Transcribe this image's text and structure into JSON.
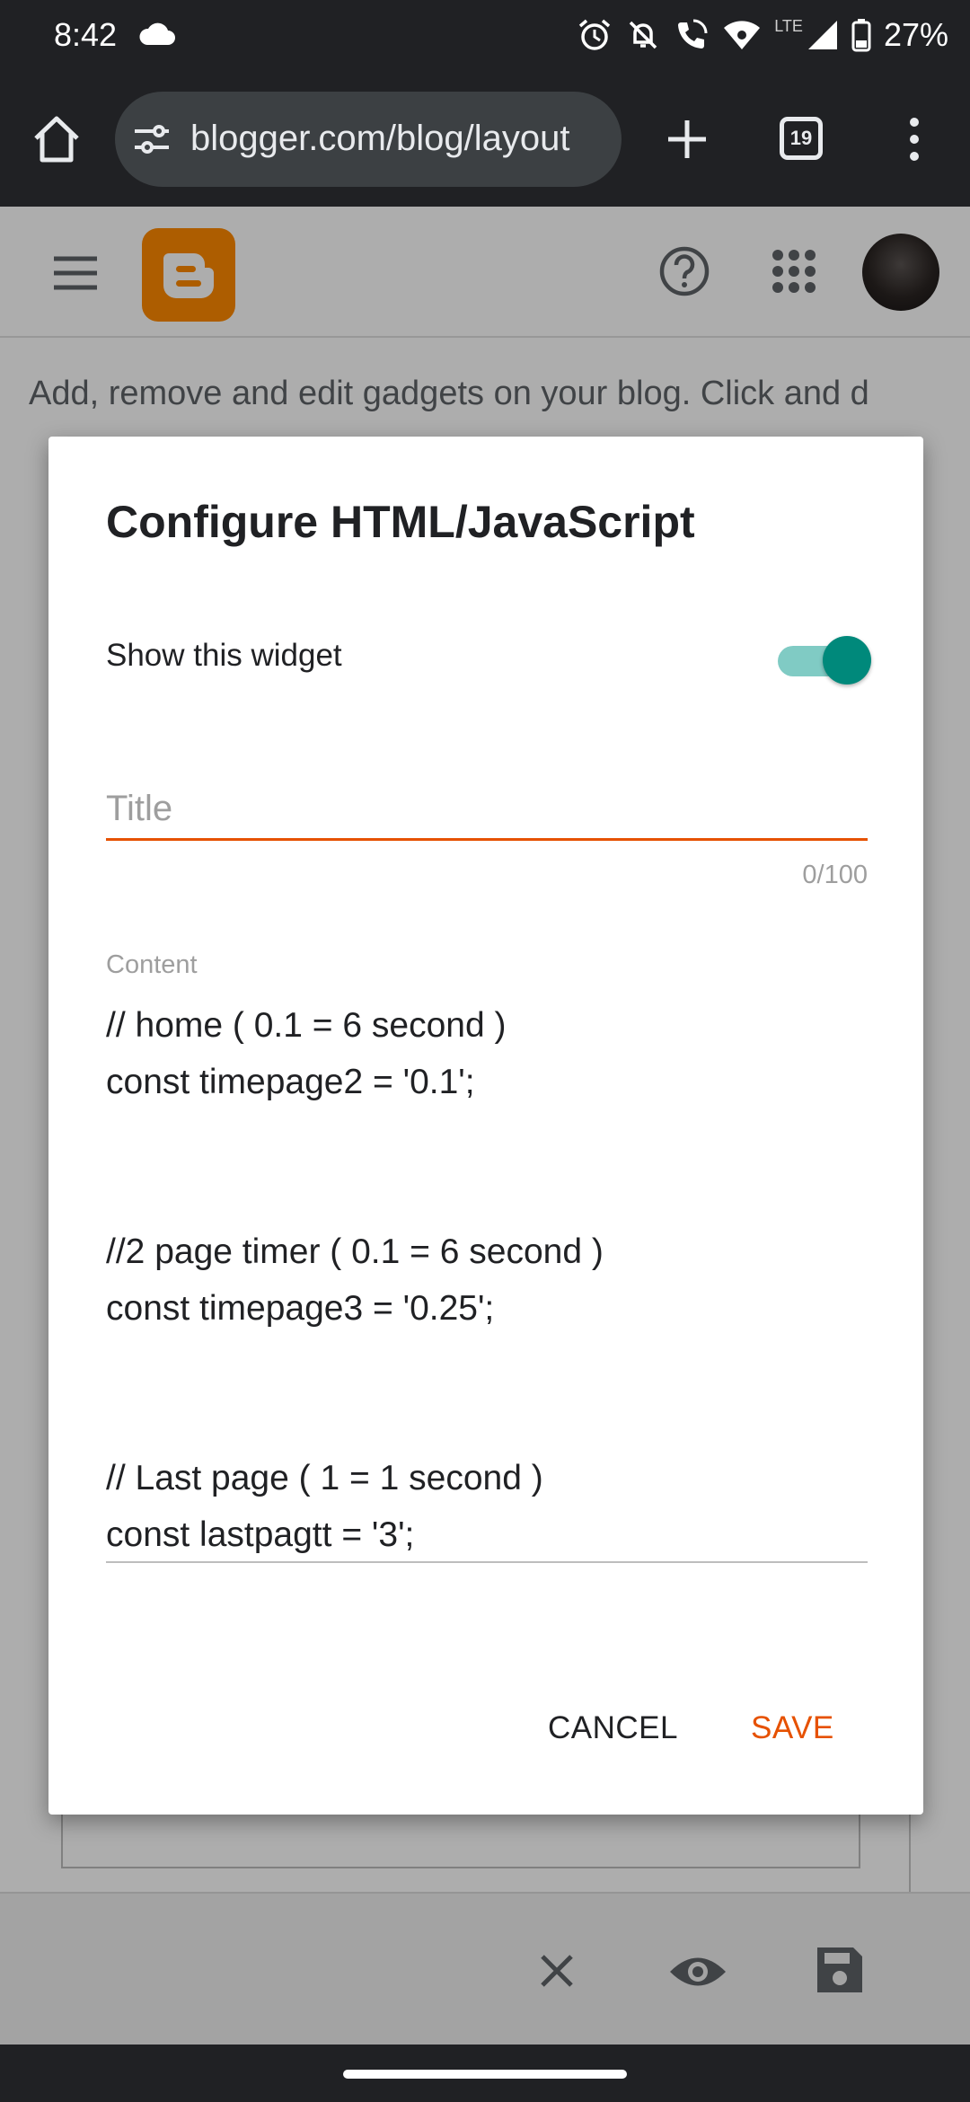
{
  "status_bar": {
    "time": "8:42",
    "battery_percent": "27%",
    "network_label": "LTE"
  },
  "browser": {
    "url": "blogger.com/blog/layout",
    "tab_count": "19"
  },
  "page": {
    "description": "Add, remove and edit gadgets on your blog. Click and d"
  },
  "dialog": {
    "title": "Configure HTML/JavaScript",
    "show_widget_label": "Show this widget",
    "show_widget_on": true,
    "title_field": {
      "value": "",
      "placeholder": "Title",
      "counter": "0/100"
    },
    "content_label": "Content",
    "content": "// home ( 0.1 = 6 second )\nconst timepage2 = '0.1';\n\n\n//2 page timer ( 0.1 = 6 second )\nconst timepage3 = '0.25';\n\n\n// Last page ( 1 = 1 second )\nconst lastpagtt = '3';",
    "cancel_label": "CANCEL",
    "save_label": "SAVE"
  },
  "colors": {
    "accent": "#e65100",
    "toggle_on": "#00897b",
    "blogger_orange": "#ff8a00"
  },
  "icons": {
    "status": [
      "cloud-icon",
      "alarm-icon",
      "notifications-off-icon",
      "wifi-calling-icon",
      "wifi-icon",
      "signal-icon",
      "battery-icon"
    ],
    "browser": [
      "home-icon",
      "tune-icon",
      "new-tab-icon",
      "tab-switcher-icon",
      "more-vert-icon"
    ],
    "header": [
      "menu-icon",
      "blogger-logo",
      "help-icon",
      "apps-icon",
      "avatar"
    ],
    "bottom_bar": [
      "close-icon",
      "preview-icon",
      "save-icon"
    ]
  }
}
